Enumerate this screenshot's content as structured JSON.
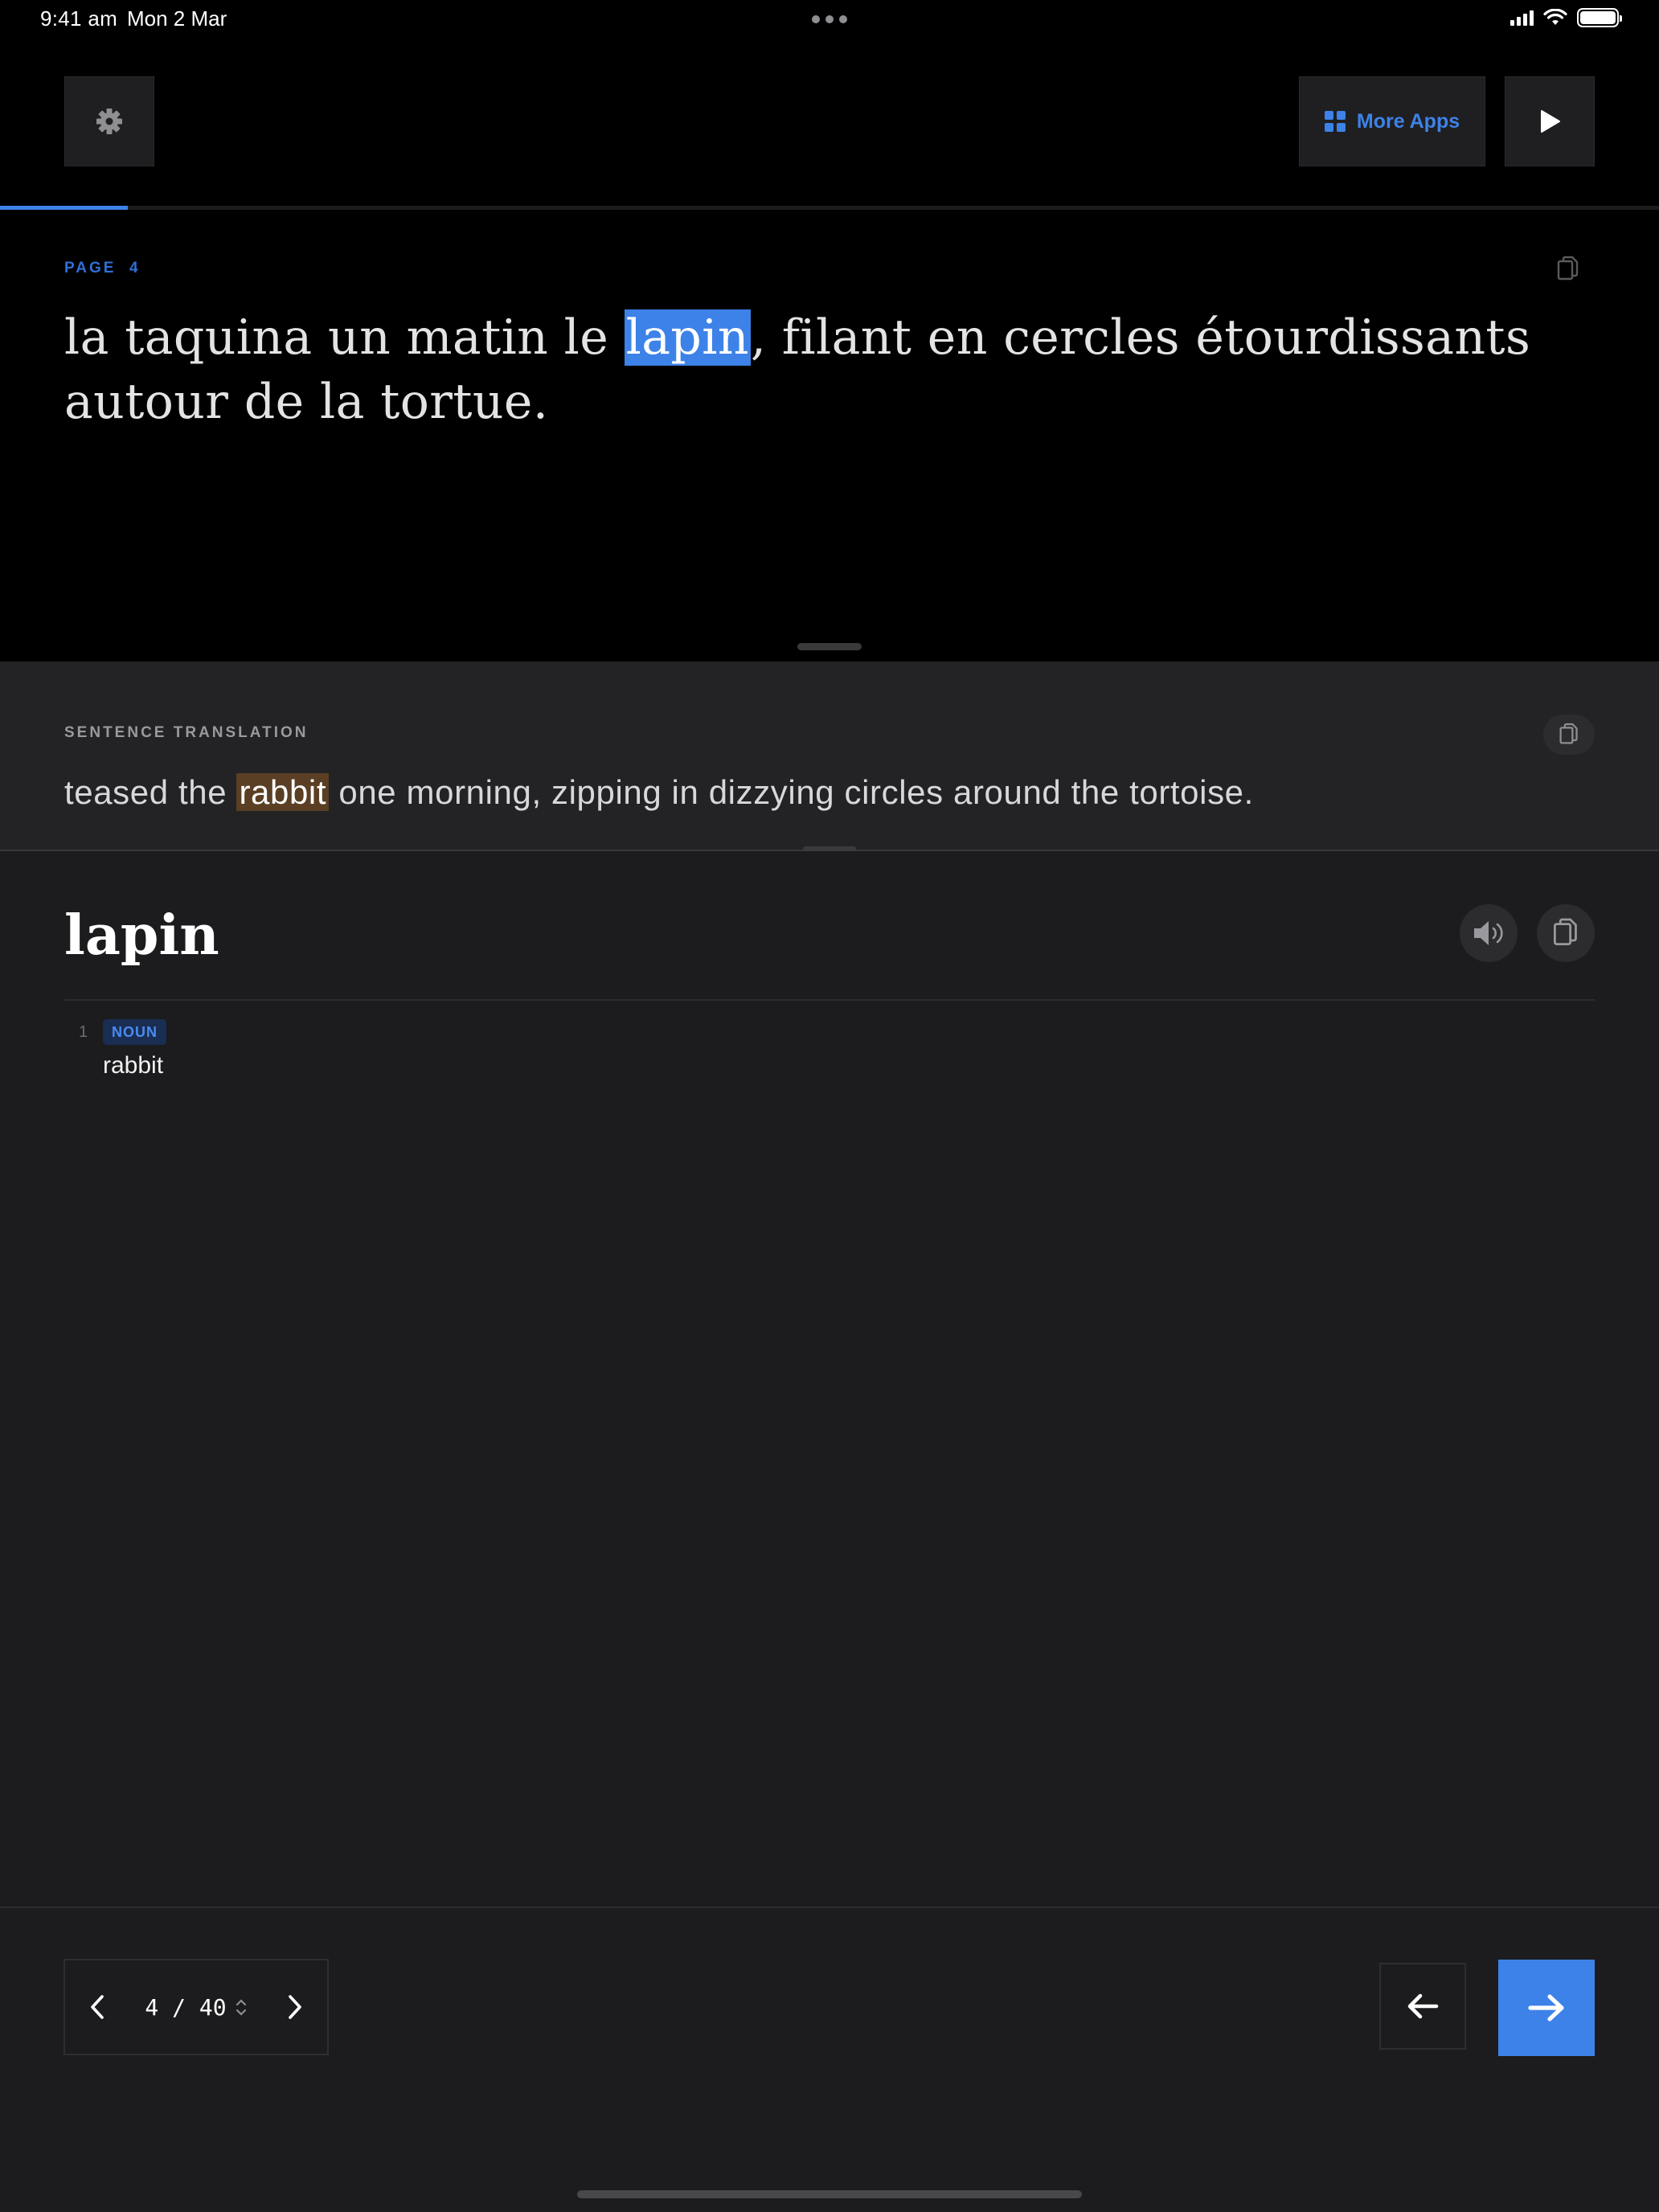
{
  "status_bar": {
    "time": "9:41 am",
    "date": "Mon 2 Mar"
  },
  "toolbar": {
    "more_apps_label": "More Apps"
  },
  "reading": {
    "progress_fraction": 0.077,
    "page_label": "PAGE  4",
    "sentence_before": "la taquina un matin le ",
    "sentence_highlight": "lapin",
    "sentence_after": ", filant en cercles étourdissants autour de la tortue."
  },
  "translation": {
    "section_label": "SENTENCE TRANSLATION",
    "before": "teased the ",
    "highlight": "rabbit",
    "after": " one morning, zipping in dizzying circles around the tortoise."
  },
  "dictionary": {
    "headword": "lapin",
    "senses": [
      {
        "number": "1",
        "part_of_speech": "NOUN",
        "definition": "rabbit"
      }
    ]
  },
  "pager": {
    "indicator": "4 / 40"
  },
  "colors": {
    "accent": "#3d82e8",
    "translation_highlight": "#5a3f24",
    "panel": "#1c1c1e",
    "background": "#000000"
  },
  "icons": [
    "gear-icon",
    "apps-grid-icon",
    "play-icon",
    "copy-icon",
    "speaker-icon",
    "chevron-left-icon",
    "chevron-right-icon",
    "arrow-left-icon",
    "arrow-right-icon"
  ]
}
